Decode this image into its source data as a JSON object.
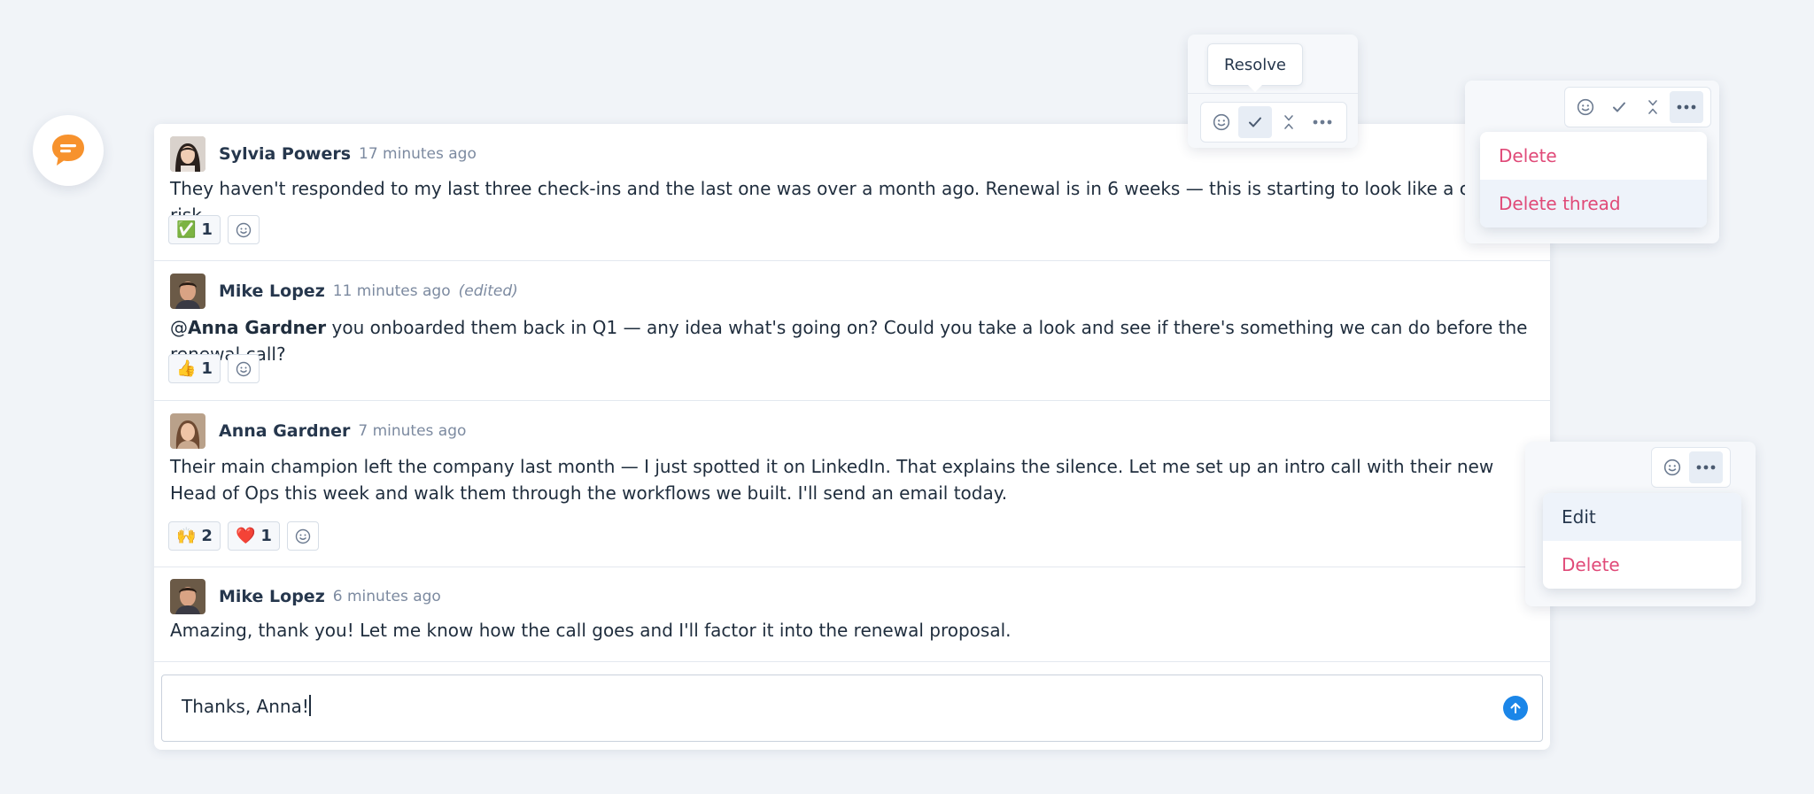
{
  "fab": {
    "icon": "chat-bubble-icon",
    "color": "#f7922d"
  },
  "comments": [
    {
      "author": "Sylvia Powers",
      "time": "17 minutes ago",
      "edited": "",
      "body": "They haven't responded to my last three check-ins and the last one was over a month ago. Renewal is in 6 weeks — this is starting to look like a churn risk.",
      "reactions": [
        {
          "emoji": "✅",
          "count": "1"
        }
      ]
    },
    {
      "author": "Mike Lopez",
      "time": "11 minutes ago",
      "edited": "(edited)",
      "mention": "Anna Gardner",
      "mention_prefix": "@",
      "body": " you onboarded them back in Q1 — any idea what's going on? Could you take a look and see if there's something we can do before the renewal call?",
      "reactions": [
        {
          "emoji": "👍",
          "count": "1"
        }
      ]
    },
    {
      "author": "Anna Gardner",
      "time": "7 minutes ago",
      "edited": "",
      "body": "Their main champion left the company last month — I just spotted it on LinkedIn. That explains the silence. Let me set up an intro call with their new Head of Ops this week and walk them through the workflows we built. I'll send an email today.",
      "reactions": [
        {
          "emoji": "🙌",
          "count": "2"
        },
        {
          "emoji": "❤️",
          "count": "1"
        }
      ]
    },
    {
      "author": "Mike Lopez",
      "time": "6 minutes ago",
      "edited": "",
      "body": "Amazing, thank you! Let me know how the call goes and I'll factor it into the renewal proposal.",
      "reactions": []
    }
  ],
  "composer": {
    "value": "Thanks, Anna!",
    "send_color": "#1b86e8"
  },
  "resolve_toolbar": {
    "tooltip": "Resolve"
  },
  "thread_menu": {
    "items": [
      "Delete",
      "Delete thread"
    ]
  },
  "comment_menu": {
    "items": [
      "Edit",
      "Delete"
    ]
  },
  "colors": {
    "danger": "#e04a78",
    "accent": "#1b86e8"
  }
}
